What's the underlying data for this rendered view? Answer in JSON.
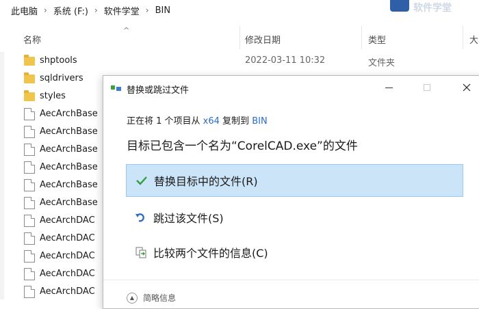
{
  "breadcrumb": [
    "此电脑",
    "系统 (F:)",
    "软件学堂",
    "BIN"
  ],
  "watermark": "软件学堂",
  "columns": {
    "name": "名称",
    "date": "修改日期",
    "type": "类型",
    "size": "大"
  },
  "files": [
    {
      "name": "shptools",
      "date": "2022-03-11 10:32",
      "type": "文件夹",
      "kind": "folder"
    },
    {
      "name": "sqldrivers",
      "date": "",
      "type": "",
      "kind": "folder"
    },
    {
      "name": "styles",
      "date": "",
      "type": "",
      "kind": "folder"
    },
    {
      "name": "AecArchBase",
      "date": "",
      "type": "",
      "kind": "file"
    },
    {
      "name": "AecArchBase",
      "date": "",
      "type": "",
      "kind": "file"
    },
    {
      "name": "AecArchBase",
      "date": "",
      "type": "",
      "kind": "file"
    },
    {
      "name": "AecArchBase",
      "date": "",
      "type": "",
      "kind": "file"
    },
    {
      "name": "AecArchBase",
      "date": "",
      "type": "",
      "kind": "file"
    },
    {
      "name": "AecArchBase",
      "date": "",
      "type": "",
      "kind": "file"
    },
    {
      "name": "AecArchDAC",
      "date": "",
      "type": "",
      "kind": "file"
    },
    {
      "name": "AecArchDAC",
      "date": "",
      "type": "",
      "kind": "file"
    },
    {
      "name": "AecArchDAC",
      "date": "",
      "type": "",
      "kind": "file"
    },
    {
      "name": "AecArchDAC",
      "date": "",
      "type": "",
      "kind": "file"
    },
    {
      "name": "AecArchDAC",
      "date": "",
      "type": "",
      "kind": "file"
    }
  ],
  "dialog": {
    "title": "替换或跳过文件",
    "subtitle_prefix": "正在将 1 个项目从 ",
    "source": "x64",
    "subtitle_mid": " 复制到 ",
    "destination": "BIN",
    "headline": "目标已包含一个名为“CorelCAD.exe”的文件",
    "options": {
      "replace": "替换目标中的文件(R)",
      "skip": "跳过该文件(S)",
      "compare": "比较两个文件的信息(C)"
    },
    "footer": "简略信息",
    "icons": {
      "app": "copy-arrows-icon",
      "replace": "checkmark-icon",
      "skip": "skip-arrow-icon",
      "compare": "compare-files-icon"
    },
    "colors": {
      "accent": "#2a6cc4",
      "selected_bg": "#cce4f7",
      "check": "#2e9e3c"
    }
  }
}
